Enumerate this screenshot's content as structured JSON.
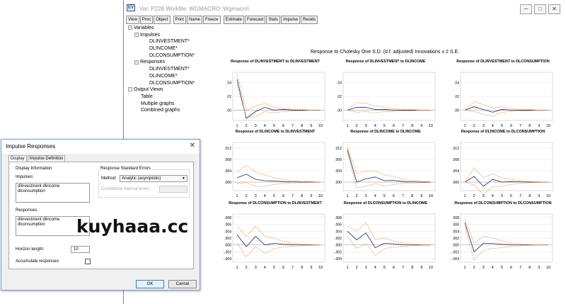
{
  "var_window": {
    "title": "Var: P228    Workfile: WGMACRO::Wgmacro\\",
    "icon": "window-app-icon",
    "controls": [
      "─",
      "□",
      "✕"
    ],
    "toolbar": [
      "View",
      "Proc",
      "Object",
      "Print",
      "Name",
      "Freeze",
      "Estimate",
      "Forecast",
      "Stats",
      "Impulse",
      "Resids"
    ]
  },
  "tree": [
    {
      "label": "Variables",
      "toggle": "−"
    },
    {
      "label": "Impulses",
      "toggle": "−"
    },
    {
      "label": "DLINVESTMENT*",
      "toggle": ""
    },
    {
      "label": "DLINCOME*",
      "toggle": ""
    },
    {
      "label": "DLCONSUMPTION*",
      "toggle": ""
    },
    {
      "label": "Responses",
      "toggle": "−"
    },
    {
      "label": "DLINVESTMENT*",
      "toggle": ""
    },
    {
      "label": "DLINCOME*",
      "toggle": ""
    },
    {
      "label": "DLCONSUMPTION*",
      "toggle": ""
    },
    {
      "label": "Output Views",
      "toggle": "−"
    },
    {
      "label": "Table",
      "toggle": ""
    },
    {
      "label": "Multiple graphs",
      "toggle": ""
    },
    {
      "label": "Combined graphs",
      "toggle": ""
    }
  ],
  "graph_title": "Response to Cholesky One S.D. (d.f. adjusted) Innovations ± 2 S.E.",
  "colors": {
    "response": "#1a2a55",
    "bands": "#f08a3c",
    "axis": "#c8c8c8",
    "titlebar": "#ffffff"
  },
  "chart_data": [
    {
      "type": "line",
      "title": "Response of DLINVESTMENT to DLINVESTMENT",
      "x": [
        1,
        2,
        3,
        4,
        5,
        6,
        7,
        8,
        9,
        10
      ],
      "yticks": [
        ".04",
        ".02",
        ".00"
      ],
      "ylim": [
        -0.015,
        0.055
      ],
      "series": [
        {
          "values": [
            0.045,
            -0.012,
            -0.002,
            0.004,
            0.0,
            0.001,
            0.0,
            0.0,
            0.0,
            0.0
          ]
        },
        {
          "values": [
            0.053,
            0.0,
            0.006,
            0.01,
            0.004,
            0.003,
            0.001,
            0.001,
            0.0,
            0.0
          ]
        },
        {
          "values": [
            0.037,
            -0.01,
            -0.01,
            -0.002,
            -0.004,
            -0.002,
            -0.001,
            -0.001,
            0.0,
            0.0
          ]
        }
      ]
    },
    {
      "type": "line",
      "title": "Response of DLINVESTMENT to DLINCOME",
      "x": [
        1,
        2,
        3,
        4,
        5,
        6,
        7,
        8,
        9,
        10
      ],
      "yticks": [
        ".04",
        ".02",
        ".00"
      ],
      "ylim": [
        -0.015,
        0.055
      ],
      "series": [
        {
          "values": [
            0.0,
            0.004,
            0.004,
            0.001,
            0.001,
            0.0,
            0.0,
            0.0,
            0.0,
            0.0
          ]
        },
        {
          "values": [
            0.0,
            0.011,
            0.01,
            0.006,
            0.004,
            0.002,
            0.001,
            0.001,
            0.0,
            0.0
          ]
        },
        {
          "values": [
            0.0,
            -0.003,
            -0.002,
            -0.004,
            -0.002,
            -0.002,
            -0.001,
            -0.001,
            0.0,
            0.0
          ]
        }
      ]
    },
    {
      "type": "line",
      "title": "Response of DLINVESTMENT to DLCONSUMPTION",
      "x": [
        1,
        2,
        3,
        4,
        5,
        6,
        7,
        8,
        9,
        10
      ],
      "yticks": [
        ".04",
        ".02",
        ".00"
      ],
      "ylim": [
        -0.015,
        0.055
      ],
      "series": [
        {
          "values": [
            0.0,
            0.005,
            0.001,
            -0.003,
            0.001,
            0.0,
            0.0,
            0.0,
            0.0,
            0.0
          ]
        },
        {
          "values": [
            0.0,
            0.012,
            0.008,
            0.003,
            0.005,
            0.002,
            0.001,
            0.001,
            0.0,
            0.0
          ]
        },
        {
          "values": [
            0.0,
            -0.002,
            -0.006,
            -0.009,
            -0.003,
            -0.002,
            -0.001,
            -0.001,
            0.0,
            0.0
          ]
        }
      ]
    },
    {
      "type": "line",
      "title": "Response of DLINCOME to DLINVESTMENT",
      "x": [
        1,
        2,
        3,
        4,
        5,
        6,
        7,
        8,
        9,
        10
      ],
      "yticks": [
        ".012",
        ".008",
        ".004",
        ".000"
      ],
      "ylim": [
        -0.003,
        0.014
      ],
      "series": [
        {
          "values": [
            0.0015,
            0.0028,
            0.001,
            0.0005,
            0.0004,
            0.0002,
            0.0001,
            0.0,
            0.0,
            0.0
          ]
        },
        {
          "values": [
            0.0035,
            0.006,
            0.0035,
            0.0025,
            0.0015,
            0.001,
            0.0005,
            0.0003,
            0.0002,
            0.0
          ]
        },
        {
          "values": [
            -0.0005,
            -0.0002,
            -0.0015,
            -0.0015,
            -0.0008,
            -0.0006,
            -0.0003,
            -0.0002,
            -0.0001,
            0.0
          ]
        }
      ]
    },
    {
      "type": "line",
      "title": "Response of DLINCOME to DLINCOME",
      "x": [
        1,
        2,
        3,
        4,
        5,
        6,
        7,
        8,
        9,
        10
      ],
      "yticks": [
        ".012",
        ".008",
        ".004",
        ".000"
      ],
      "ylim": [
        -0.003,
        0.014
      ],
      "series": [
        {
          "values": [
            0.0115,
            0.0,
            0.0012,
            0.0018,
            0.0005,
            0.0006,
            0.0002,
            0.0001,
            0.0,
            0.0
          ]
        },
        {
          "values": [
            0.0125,
            0.003,
            0.004,
            0.004,
            0.0025,
            0.002,
            0.001,
            0.0005,
            0.0003,
            0.0001
          ]
        },
        {
          "values": [
            0.0105,
            -0.002,
            -0.0015,
            -0.0005,
            -0.0015,
            -0.0008,
            -0.0005,
            -0.0003,
            -0.0002,
            -0.0001
          ]
        }
      ]
    },
    {
      "type": "line",
      "title": "Response of DLINCOME to DLCONSUMPTION",
      "x": [
        1,
        2,
        3,
        4,
        5,
        6,
        7,
        8,
        9,
        10
      ],
      "yticks": [
        ".012",
        ".008",
        ".004",
        ".000"
      ],
      "ylim": [
        -0.003,
        0.014
      ],
      "series": [
        {
          "values": [
            0.0,
            0.002,
            -0.0015,
            0.001,
            0.0,
            0.0002,
            0.0001,
            0.0,
            0.0,
            0.0
          ]
        },
        {
          "values": [
            0.0,
            0.005,
            0.0015,
            0.003,
            0.0015,
            0.001,
            0.0005,
            0.0002,
            0.0001,
            0.0
          ]
        },
        {
          "values": [
            0.0,
            -0.001,
            -0.0045,
            -0.0015,
            -0.0015,
            -0.0008,
            -0.0004,
            -0.0002,
            -0.0001,
            0.0
          ]
        }
      ]
    },
    {
      "type": "line",
      "title": "Response of DLCONSUMPTION to DLINVESTMENT",
      "x": [
        1,
        2,
        3,
        4,
        5,
        6,
        7,
        8,
        9,
        10
      ],
      "yticks": [
        ".008",
        ".006",
        ".004",
        ".002",
        ".000",
        "-.002",
        "-.004"
      ],
      "ylim": [
        -0.005,
        0.009
      ],
      "series": [
        {
          "values": [
            0.003,
            -0.0005,
            0.0025,
            0.0,
            0.0005,
            0.0002,
            0.0001,
            0.0,
            0.0,
            0.0
          ]
        },
        {
          "values": [
            0.0055,
            0.0025,
            0.0055,
            0.0025,
            0.002,
            0.001,
            0.0006,
            0.0003,
            0.0001,
            0.0
          ]
        },
        {
          "values": [
            0.0005,
            -0.0035,
            -0.0005,
            -0.0025,
            -0.001,
            -0.0006,
            -0.0004,
            -0.0002,
            -0.0001,
            0.0
          ]
        }
      ]
    },
    {
      "type": "line",
      "title": "Response of DLCONSUMPTION to DLINCOME",
      "x": [
        1,
        2,
        3,
        4,
        5,
        6,
        7,
        8,
        9,
        10
      ],
      "yticks": [
        ".008",
        ".006",
        ".004",
        ".002",
        ".000",
        "-.002",
        "-.004"
      ],
      "ylim": [
        -0.005,
        0.009
      ],
      "series": [
        {
          "values": [
            0.004,
            0.0015,
            0.0035,
            -0.0008,
            0.0005,
            0.0003,
            0.0001,
            0.0,
            0.0,
            0.0
          ]
        },
        {
          "values": [
            0.0055,
            0.004,
            0.0065,
            0.0015,
            0.002,
            0.0012,
            0.0006,
            0.0003,
            0.0001,
            0.0
          ]
        },
        {
          "values": [
            0.0025,
            -0.001,
            0.0005,
            -0.003,
            -0.001,
            -0.0006,
            -0.0004,
            -0.0002,
            -0.0001,
            0.0
          ]
        }
      ]
    },
    {
      "type": "line",
      "title": "Response of DLCONSUMPTION to DLCONSUMPTION",
      "x": [
        1,
        2,
        3,
        4,
        5,
        6,
        7,
        8,
        9,
        10
      ],
      "yticks": [
        ".008",
        ".006",
        ".004",
        ".002",
        ".000",
        "-.002",
        "-.004"
      ],
      "ylim": [
        -0.005,
        0.009
      ],
      "series": [
        {
          "values": [
            0.0065,
            -0.002,
            0.0005,
            0.0004,
            0.0002,
            0.0001,
            0.0,
            0.0,
            0.0,
            0.0
          ]
        },
        {
          "values": [
            0.0075,
            0.0005,
            0.0025,
            0.002,
            0.0012,
            0.0006,
            0.0003,
            0.0001,
            0.0,
            0.0
          ]
        },
        {
          "values": [
            0.0055,
            -0.0045,
            -0.0015,
            -0.001,
            -0.0008,
            -0.0004,
            -0.0002,
            -0.0001,
            0.0,
            0.0
          ]
        }
      ]
    }
  ],
  "dialog": {
    "title": "Impulse Responses",
    "close": "✕",
    "tabs": [
      "Display",
      "Impulse Definition"
    ],
    "display_info_label": "Display Information",
    "impulses_label": "Impulses:",
    "impulses_value": "dlinvestment dlincome\ndlconsumption",
    "responses_label": "Responses:",
    "responses_value": "dlinvestment dlincome\ndlconsumption",
    "horizon_label": "Horizon length:",
    "horizon_value": "10",
    "accumulate_label": "Accumulate responses:",
    "se_group_label": "Response Standard Errors",
    "method_label": "Method:",
    "method_value": "Analytic (asymptotic)",
    "ci_label": "Confidence interval levels:",
    "ok": "OK",
    "cancel": "Cancel"
  },
  "watermark": "kuyhaaa.cc"
}
